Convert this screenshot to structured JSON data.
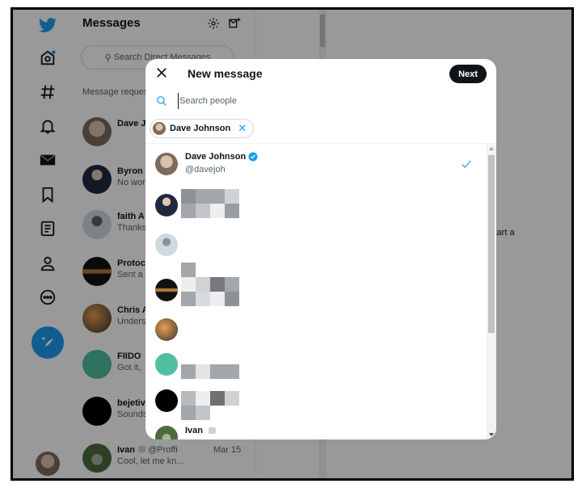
{
  "messages_panel": {
    "title": "Messages",
    "search_placeholder": "Search Direct Messages",
    "requests_label": "Message requests",
    "conversations": [
      {
        "name": "Dave Jo",
        "preview": "",
        "avatar": "photo-man-older"
      },
      {
        "name": "Byron",
        "preview": "No wor",
        "avatar": "photo-man-suit"
      },
      {
        "name": "faith A",
        "preview": "Thanks",
        "avatar": "default-avatar"
      },
      {
        "name": "Protoc",
        "preview": "Sent a",
        "avatar": "travelers-logo"
      },
      {
        "name": "Chris A",
        "preview": "Unders",
        "avatar": "photo-person"
      },
      {
        "name": "FIIDO",
        "preview": "Got it,",
        "avatar": "fiido-logo"
      },
      {
        "name": "bejetiv",
        "preview": "Sounds",
        "avatar": "black-logo"
      },
      {
        "name": "Ivan",
        "handle": "@Proffi",
        "date": "Mar 15",
        "preview": "Cool, let me kn...",
        "avatar": "photo-outdoor"
      }
    ]
  },
  "nav": {
    "items": [
      "twitter-logo",
      "home",
      "explore",
      "notifications",
      "messages",
      "bookmarks",
      "lists",
      "profile",
      "more"
    ],
    "compose_label": "Tweet"
  },
  "right_pane": {
    "hint": "start a"
  },
  "modal": {
    "title": "New message",
    "next_label": "Next",
    "search_placeholder": "Search people",
    "search_value": "",
    "selected_chip": {
      "name": "Dave Johnson"
    },
    "people": [
      {
        "name": "Dave Johnson",
        "handle": "@davejoh",
        "verified": true,
        "selected": true
      },
      {
        "name": "",
        "handle": "",
        "redacted": true
      },
      {
        "name": "",
        "handle": "",
        "redacted": false
      },
      {
        "name": "",
        "handle": "",
        "redacted": true
      },
      {
        "name": "",
        "handle": "",
        "redacted": false
      },
      {
        "name": "",
        "handle": "",
        "redacted": true
      },
      {
        "name": "",
        "handle": "",
        "redacted": true
      },
      {
        "name": "Ivan",
        "handle": "",
        "verified": false
      }
    ]
  },
  "colors": {
    "accent": "#1d9bf0",
    "overlay": "rgba(0,0,0,0.4)",
    "button_dark": "#0f1419"
  }
}
